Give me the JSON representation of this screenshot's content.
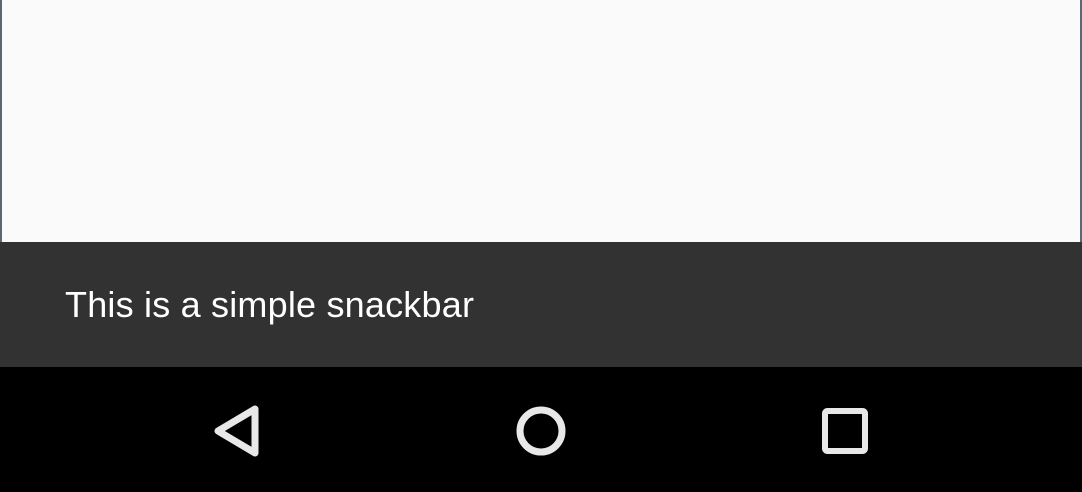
{
  "content": {
    "background": "#fafafa"
  },
  "snackbar": {
    "message": "This is a simple snackbar",
    "background": "#323232",
    "text_color": "#ffffff"
  },
  "navigation_bar": {
    "background": "#000000",
    "buttons": [
      {
        "name": "back",
        "icon": "triangle-back-icon"
      },
      {
        "name": "home",
        "icon": "circle-home-icon"
      },
      {
        "name": "recents",
        "icon": "square-recents-icon"
      }
    ],
    "icon_color": "#e8e8e8"
  }
}
